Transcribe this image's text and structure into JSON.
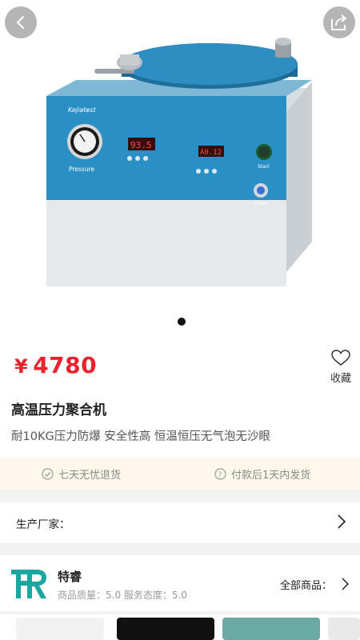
{
  "header": {
    "back_icon": "chevron-left-icon",
    "share_icon": "share-icon"
  },
  "gallery": {
    "page_indicator_count": 1,
    "active_index": 0,
    "product_labels": {
      "brand": "Kejiatest",
      "gauge": "Pressure",
      "display_left": "93.5",
      "display_right": "A0.12",
      "start": "Start",
      "power": "Power"
    }
  },
  "product": {
    "currency": "¥",
    "price": "4780",
    "favorite_label": "收藏",
    "title": "高温压力聚合机",
    "subtitle": "耐10KG压力防爆 安全性高 恒温恒压无气泡无沙眼"
  },
  "guarantees": [
    {
      "icon": "check-circle-icon",
      "label": "七天无忧退货"
    },
    {
      "icon": "question-circle-icon",
      "label": "付款后1天内发货"
    }
  ],
  "manufacturer": {
    "label": "生产厂家："
  },
  "shop": {
    "name": "特睿",
    "rating_text": "商品质量：5.0  服务态度：5.0",
    "all_products_label": "全部商品："
  },
  "colors": {
    "price": "#e8232c",
    "guarantee_bg": "#fdf8ea",
    "machine_blue": "#2a8fc4",
    "logo_teal": "#1aa7a0"
  }
}
